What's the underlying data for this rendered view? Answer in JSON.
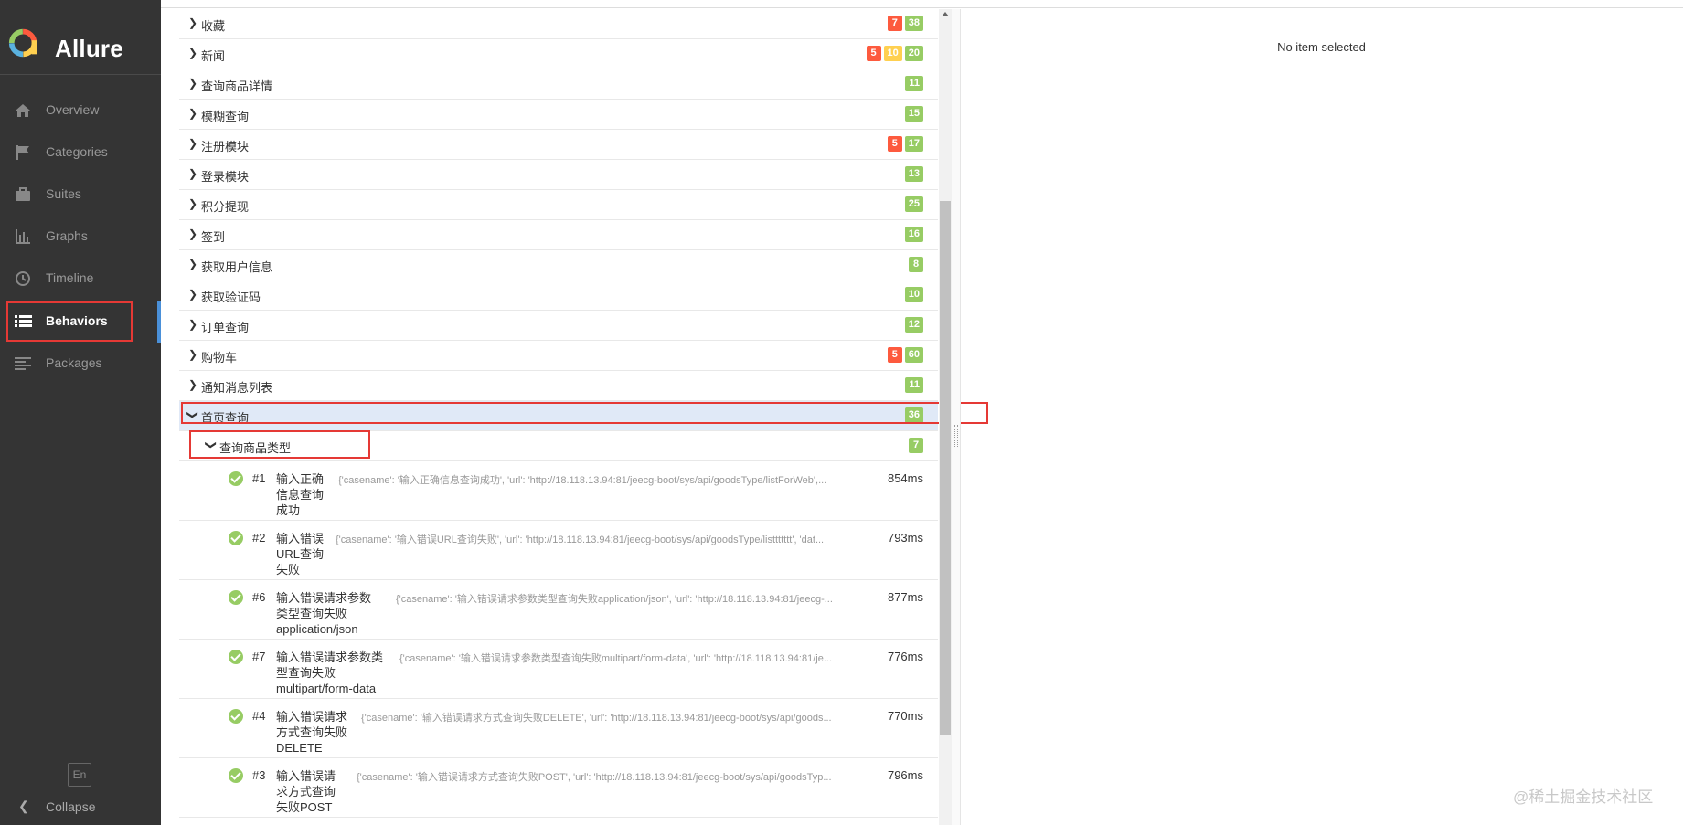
{
  "app": {
    "name": "Allure"
  },
  "sidebar": {
    "items": [
      {
        "label": "Overview",
        "icon": "home-icon"
      },
      {
        "label": "Categories",
        "icon": "flag-icon"
      },
      {
        "label": "Suites",
        "icon": "briefcase-icon"
      },
      {
        "label": "Graphs",
        "icon": "bar-chart-icon"
      },
      {
        "label": "Timeline",
        "icon": "clock-icon"
      },
      {
        "label": "Behaviors",
        "icon": "list-icon",
        "active": true
      },
      {
        "label": "Packages",
        "icon": "align-left-icon"
      }
    ],
    "language": "En",
    "collapse_label": "Collapse"
  },
  "colors": {
    "failed": "#fd5a3e",
    "broken": "#ffd050",
    "passed": "#97cc64",
    "highlight": "#e53935",
    "active_accent": "#4a90d9"
  },
  "tree": {
    "rows": [
      {
        "name": "收藏",
        "badges": {
          "failed": "7",
          "passed": "38"
        }
      },
      {
        "name": "新闻",
        "badges": {
          "failed": "5",
          "broken": "10",
          "passed": "20"
        }
      },
      {
        "name": "查询商品详情",
        "badges": {
          "passed": "11"
        }
      },
      {
        "name": "模糊查询",
        "badges": {
          "passed": "15"
        }
      },
      {
        "name": "注册模块",
        "badges": {
          "failed": "5",
          "passed": "17"
        }
      },
      {
        "name": "登录模块",
        "badges": {
          "passed": "13"
        }
      },
      {
        "name": "积分提现",
        "badges": {
          "passed": "25"
        }
      },
      {
        "name": "签到",
        "badges": {
          "passed": "16"
        }
      },
      {
        "name": "获取用户信息",
        "badges": {
          "passed": "8"
        }
      },
      {
        "name": "获取验证码",
        "badges": {
          "passed": "10"
        }
      },
      {
        "name": "订单查询",
        "badges": {
          "passed": "12"
        }
      },
      {
        "name": "购物车",
        "badges": {
          "failed": "5",
          "passed": "60"
        }
      },
      {
        "name": "通知消息列表",
        "badges": {
          "passed": "11"
        }
      }
    ],
    "expanded": {
      "name": "首页查询",
      "badges": {
        "passed": "36"
      }
    },
    "subgroup": {
      "name": "查询商品类型",
      "badges": {
        "passed": "7"
      }
    },
    "tests": [
      {
        "num": "#1",
        "title_lines": [
          "输入正确",
          "信息查询",
          "成功"
        ],
        "params": "{'casename': '输入正确信息查询成功', 'url': 'http://18.118.13.94:81/jeecg-boot/sys/api/goodsType/listForWeb',...",
        "duration": "854ms"
      },
      {
        "num": "#2",
        "title_lines": [
          "输入错误",
          "URL查询",
          "失败"
        ],
        "params": "{'casename': '输入错误URL查询失败', 'url': 'http://18.118.13.94:81/jeecg-boot/sys/api/goodsType/listtttttt', 'dat...",
        "duration": "793ms"
      },
      {
        "num": "#6",
        "title_lines": [
          "输入错误请求参数",
          "类型查询失败",
          "application/json"
        ],
        "params": "{'casename': '输入错误请求参数类型查询失败application/json', 'url': 'http://18.118.13.94:81/jeecg-...",
        "duration": "877ms"
      },
      {
        "num": "#7",
        "title_lines": [
          "输入错误请求参数类",
          "型查询失败",
          "multipart/form-data"
        ],
        "params": "{'casename': '输入错误请求参数类型查询失败multipart/form-data', 'url': 'http://18.118.13.94:81/je...",
        "duration": "776ms"
      },
      {
        "num": "#4",
        "title_lines": [
          "输入错误请求",
          "方式查询失败",
          "DELETE"
        ],
        "params": "{'casename': '输入错误请求方式查询失败DELETE', 'url': 'http://18.118.13.94:81/jeecg-boot/sys/api/goods...",
        "duration": "770ms"
      },
      {
        "num": "#3",
        "title_lines": [
          "输入错误请",
          "求方式查询",
          "失败POST"
        ],
        "params": "{'casename': '输入错误请求方式查询失败POST', 'url': 'http://18.118.13.94:81/jeecg-boot/sys/api/goodsTyp...",
        "duration": "796ms"
      }
    ]
  },
  "detail": {
    "empty_text": "No item selected"
  },
  "watermark": "@稀土掘金技术社区"
}
